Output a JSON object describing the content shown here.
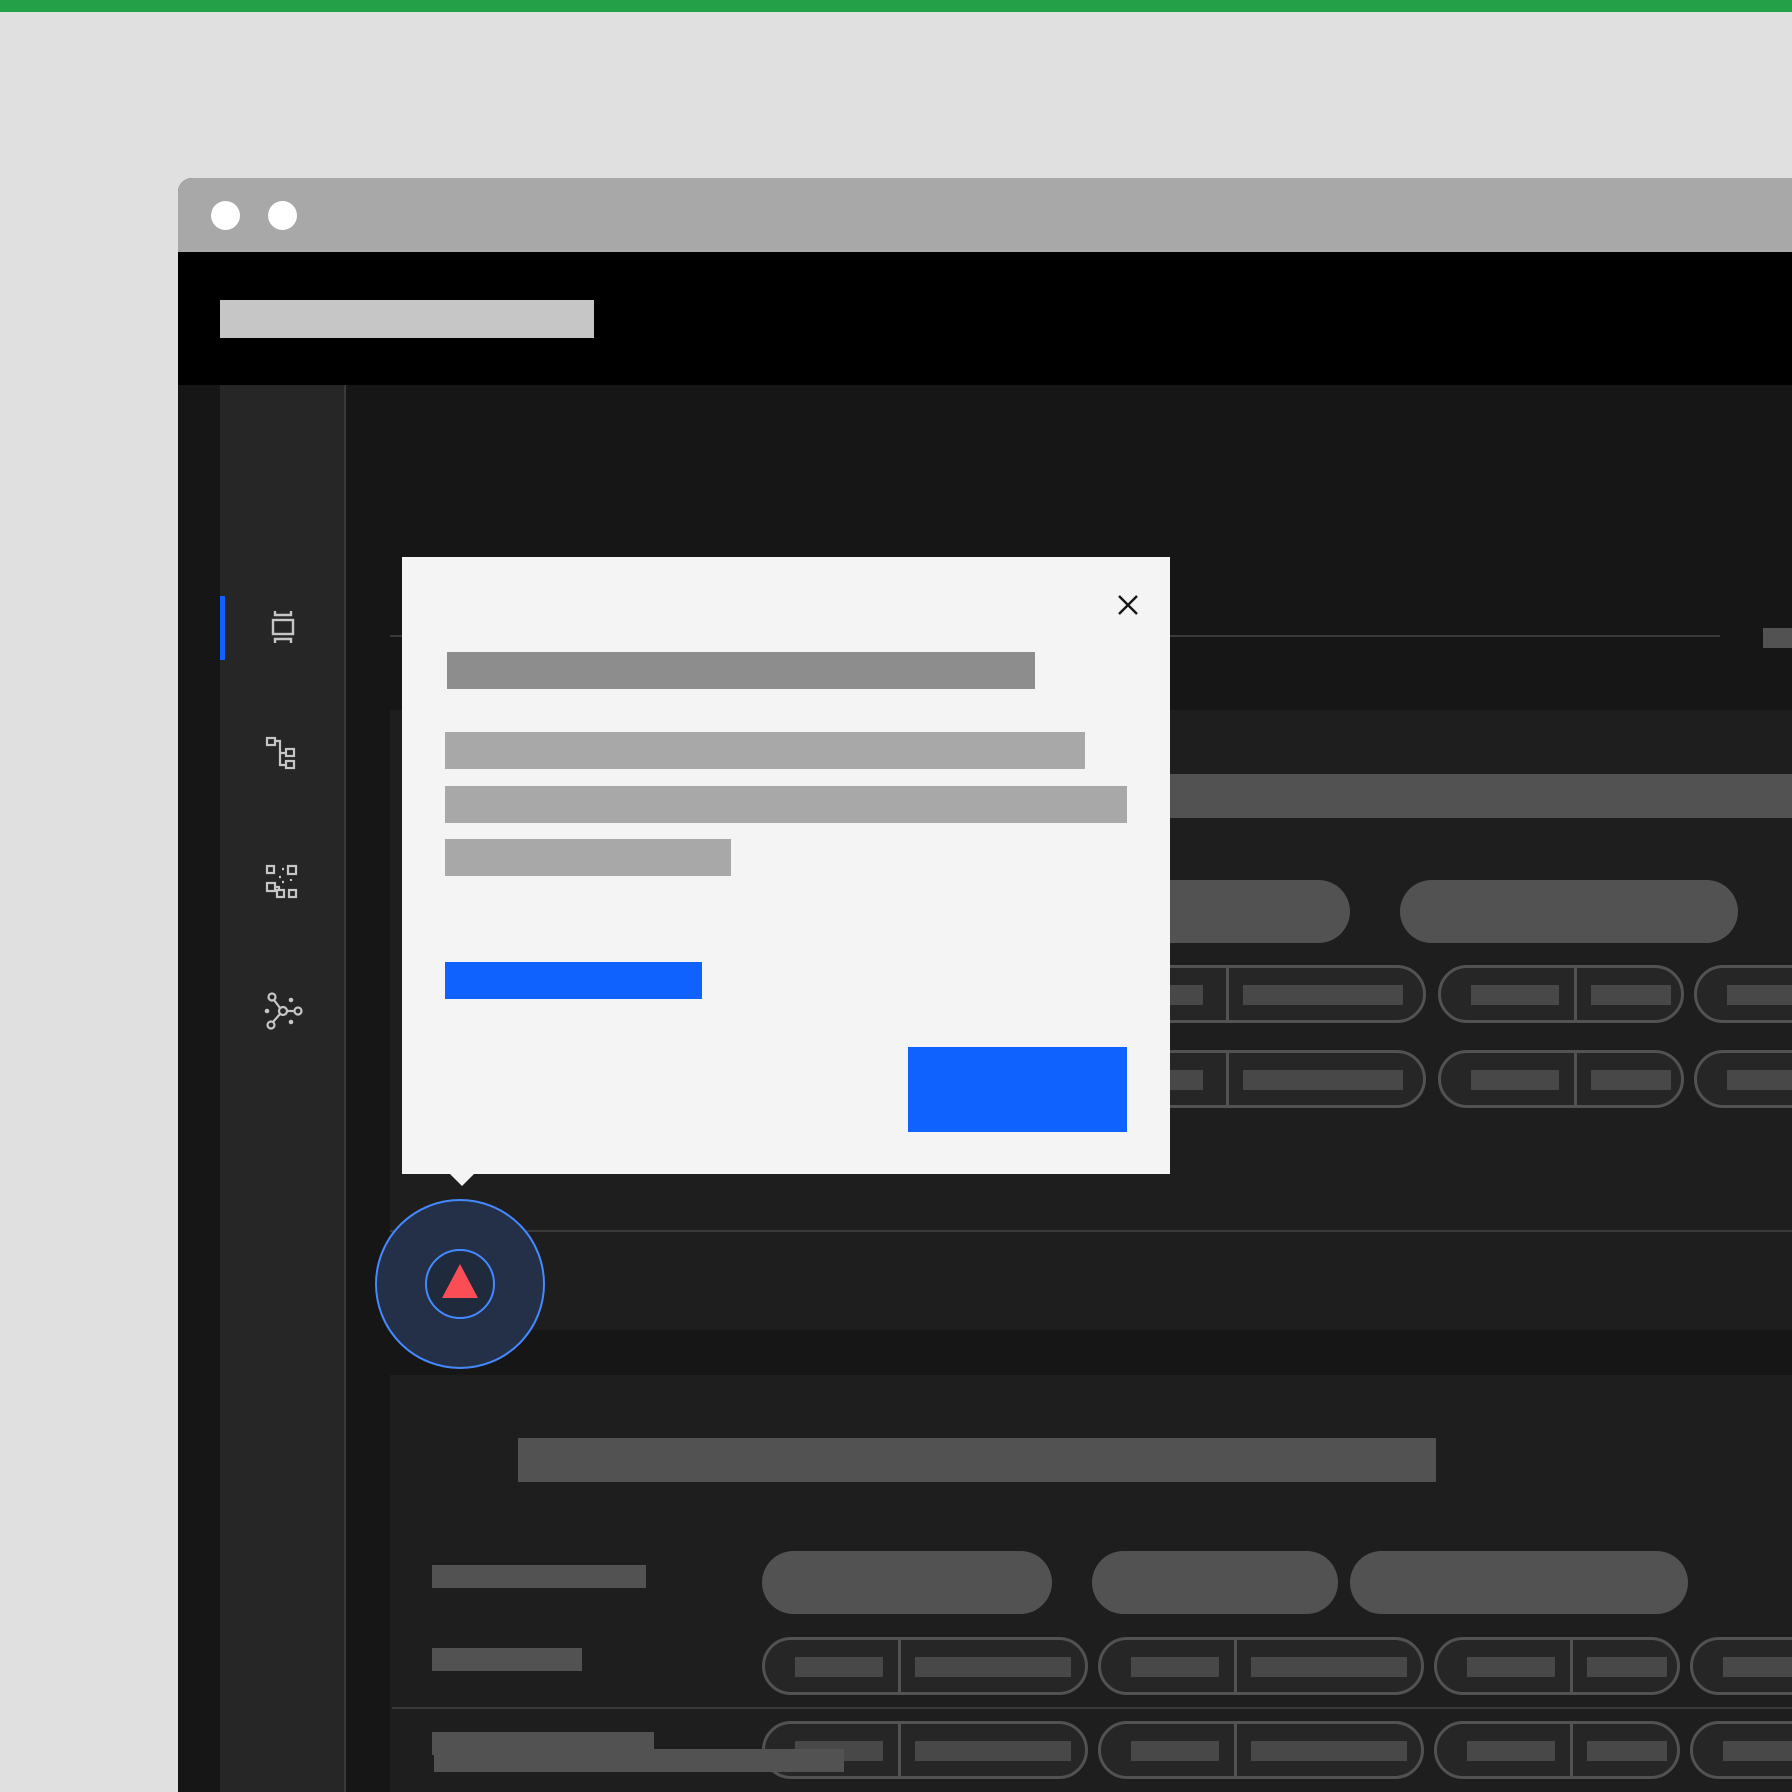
{
  "app": {
    "window_controls": [
      "close",
      "minimize"
    ],
    "header_title": "",
    "sidebar": {
      "items": [
        {
          "icon": "center-to-fit-icon",
          "active": true
        },
        {
          "icon": "tree-view-icon",
          "active": false
        },
        {
          "icon": "data-structured-icon",
          "active": false
        },
        {
          "icon": "network-icon",
          "active": false
        }
      ]
    }
  },
  "popover": {
    "title": "",
    "body_lines": [
      "",
      "",
      ""
    ],
    "link_label": "",
    "primary_button_label": "",
    "close_icon": "close-icon"
  },
  "hotspot": {
    "icon": "warning-triangle-icon"
  },
  "colors": {
    "accent": "#0f62fe",
    "warning": "#fa4d56",
    "focus_ring": "#4589ff",
    "top_stripe": "#24a148"
  }
}
